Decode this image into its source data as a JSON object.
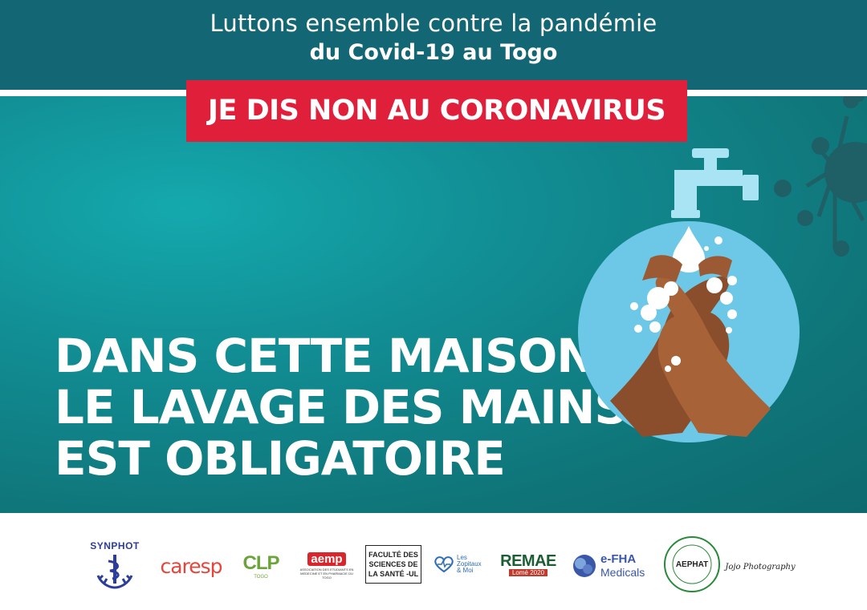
{
  "header": {
    "line1": "Luttons ensemble contre la pandémie",
    "line2": "du Covid-19 au Togo"
  },
  "slogan": "JE DIS NON AU CORONAVIRUS",
  "headline": [
    "DANS CETTE  MAISON,",
    "LE LAVAGE DES  MAINS",
    "EST OBLIGATOIRE"
  ],
  "colors": {
    "header_bg": "#136673",
    "main_bg": "#118d93",
    "slogan_bg": "#e01f3a",
    "circle": "#6cc8e6",
    "faucet": "#a8e4f4",
    "skin": "#9c5a34"
  },
  "illustration": {
    "icons": [
      "faucet-icon",
      "water-drop-icon",
      "washing-hands-icon",
      "virus-icon"
    ]
  },
  "partners": [
    {
      "name": "SYNPHOT"
    },
    {
      "name": "caresp"
    },
    {
      "name": "CLP",
      "sub": "TOGO"
    },
    {
      "name": "aemp",
      "sub": "ASSOCIATION DES ETUDIANTS EN MEDECINE ET EN PHARMACIE DU TOGO"
    },
    {
      "lines": [
        "FACULTÉ DES",
        "SCIENCES DE",
        "LA SANTÉ -UL"
      ]
    },
    {
      "name": "Les Zopitaux & Moi"
    },
    {
      "name": "REMAE",
      "sub": "Lomé 2020"
    },
    {
      "name": "e-FHA",
      "sub": "Medicals"
    },
    {
      "name": "AEPHAT",
      "ring": "ASSOCIATION DES ETUDIANTS EN PHARMACIE DU TOGO"
    },
    {
      "name": "Jojo Photography"
    }
  ]
}
